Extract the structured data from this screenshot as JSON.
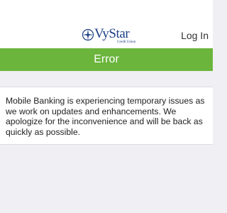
{
  "header": {
    "logo_text": "VyStar",
    "logo_subtext": "Credit Union",
    "login_label": "Log In"
  },
  "titlebar": {
    "title": "Error"
  },
  "content": {
    "message": "Mobile Banking is experiencing temporary issues as we work on updates and enhancements. We apologize for the inconvenience and will be back as quickly as possible."
  },
  "colors": {
    "brand_green": "#6bb53d",
    "brand_navy": "#1d3f87",
    "page_background": "#efeff4"
  }
}
